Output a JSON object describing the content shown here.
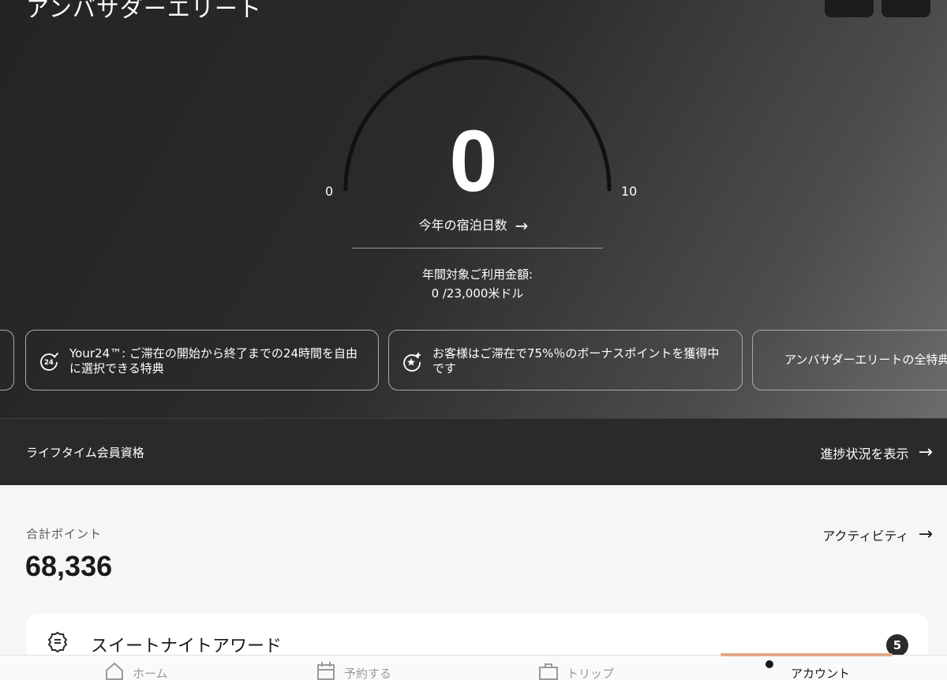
{
  "header": {
    "title": "アンバサダーエリート"
  },
  "gauge": {
    "value": "0",
    "min_label": "0",
    "max_label": "10",
    "progress_fraction": 0,
    "caption": "今年の宿泊日数",
    "caption_arrow": "→"
  },
  "spend": {
    "label": "年間対象ご利用金額:",
    "value": "0 /23,000米ドル"
  },
  "benefits": [
    {
      "text": "Your24™: ご滞在の開始から終了までの24時間を自由に選択できる特典",
      "icon": "24-check-icon"
    },
    {
      "text": "お客様はご滞在で75%％のボーナスポイントを獲得中です",
      "icon": "star-bonus-icon"
    },
    {
      "text": "アンバサダーエリートの全特典"
    }
  ],
  "lifetime": {
    "label": "ライフタイム会員資格",
    "link": "進捗状況を表示",
    "arrow": "→"
  },
  "points": {
    "label": "合計ポイント",
    "value": "68,336",
    "activity_link": "アクティビティ",
    "arrow": "→"
  },
  "award": {
    "title": "スイートナイトアワード",
    "count": "5",
    "icon": "award-ribbon-icon"
  },
  "tabs": [
    {
      "label": "ホーム",
      "icon": "home-icon"
    },
    {
      "label": "予約する",
      "icon": "calendar-icon"
    },
    {
      "label": "トリップ",
      "icon": "suitcase-icon"
    },
    {
      "label": "アカウント",
      "icon": "account-dot-icon"
    }
  ],
  "colors": {
    "hero_dark": "#2a2a2b",
    "tab_indicator": "#e2a987",
    "badge": "#2a2a2a"
  }
}
